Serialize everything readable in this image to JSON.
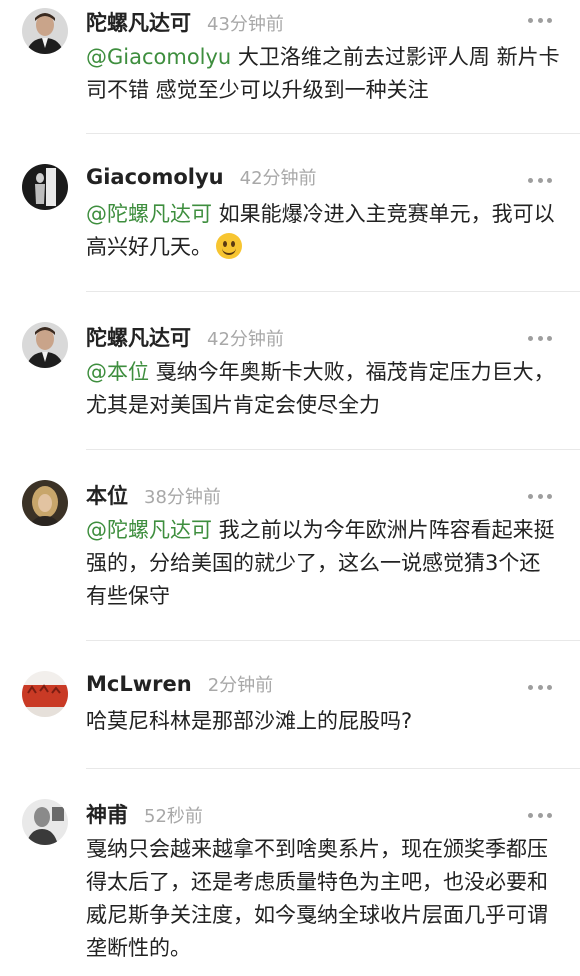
{
  "comments": [
    {
      "user": "陀螺凡达可",
      "time": "43分钟前",
      "mention": "@Giacomolyu",
      "text": " 大卫洛维之前去过影评人周 新片卡司不错 感觉至少可以升级到一种关注"
    },
    {
      "user": "Giacomolyu",
      "time": "42分钟前",
      "mention": "@陀螺凡达可",
      "text": "  如果能爆冷进入主竞赛单元，我可以高兴好几天。",
      "emoji": "smiling-face-emoji"
    },
    {
      "user": "陀螺凡达可",
      "time": "42分钟前",
      "mention": "@本位",
      "text": " 戛纳今年奥斯卡大败，福茂肯定压力巨大，尤其是对美国片肯定会使尽全力"
    },
    {
      "user": "本位",
      "time": "38分钟前",
      "mention": "@陀螺凡达可",
      "text": " 我之前以为今年欧洲片阵容看起来挺强的，分给美国的就少了，这么一说感觉猜3个还有些保守"
    },
    {
      "user": "McLwren",
      "time": "2分钟前",
      "mention": "",
      "text": "哈莫尼科林是那部沙滩上的屁股吗?"
    },
    {
      "user": "神甫",
      "time": "52秒前",
      "mention": "",
      "text": "戛纳只会越来越拿不到啥奥系片，现在颁奖季都压得太后了，还是考虑质量特色为主吧，也没必要和威尼斯争关注度，如今戛纳全球收片层面几乎可谓垄断性的。"
    }
  ],
  "icons": {
    "more": "more-horizontal-icon",
    "avatar": "user-avatar"
  },
  "colors": {
    "mention": "#3e8e3e",
    "time": "#a8a8a8",
    "divider": "#e8e8e8"
  }
}
